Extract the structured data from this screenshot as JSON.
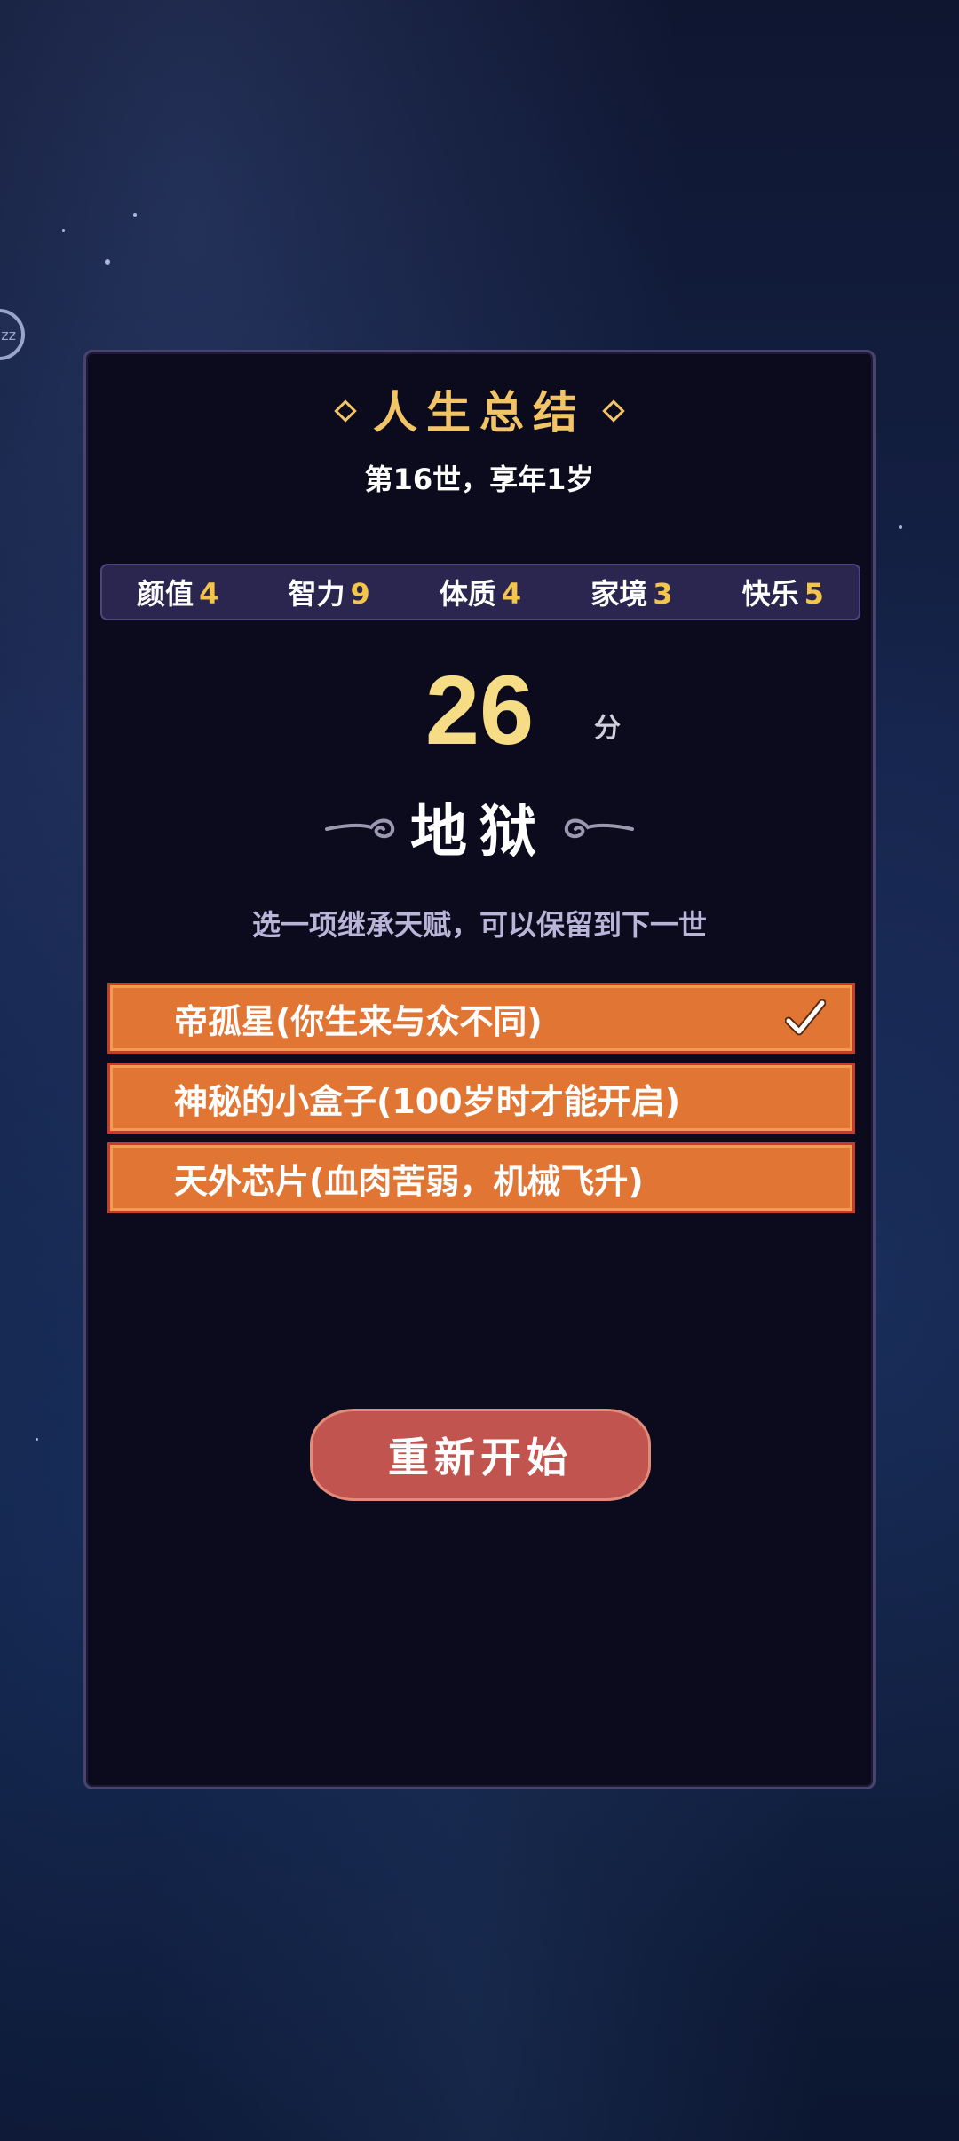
{
  "summary": {
    "title": "人生总结",
    "subtitle": "第16世，享年1岁"
  },
  "stats": [
    {
      "label": "颜值",
      "value": "4"
    },
    {
      "label": "智力",
      "value": "9"
    },
    {
      "label": "体质",
      "value": "4"
    },
    {
      "label": "家境",
      "value": "3"
    },
    {
      "label": "快乐",
      "value": "5"
    }
  ],
  "score": {
    "value": "26",
    "unit": "分",
    "grade": "地狱"
  },
  "inherit_hint": "选一项继承天赋，可以保留到下一世",
  "talents": [
    {
      "label": "帝孤星(你生来与众不同)",
      "selected": true
    },
    {
      "label": "神秘的小盒子(100岁时才能开启)",
      "selected": false
    },
    {
      "label": "天外芯片(血肉苦弱，机械飞升)",
      "selected": false
    }
  ],
  "restart_label": "重新开始",
  "floating_button_label": "zz",
  "colors": {
    "accent_gold": "#f2c468",
    "talent_bg": "#e07534",
    "restart_bg": "#c2544f",
    "panel_bg": "#0c0b1d"
  }
}
